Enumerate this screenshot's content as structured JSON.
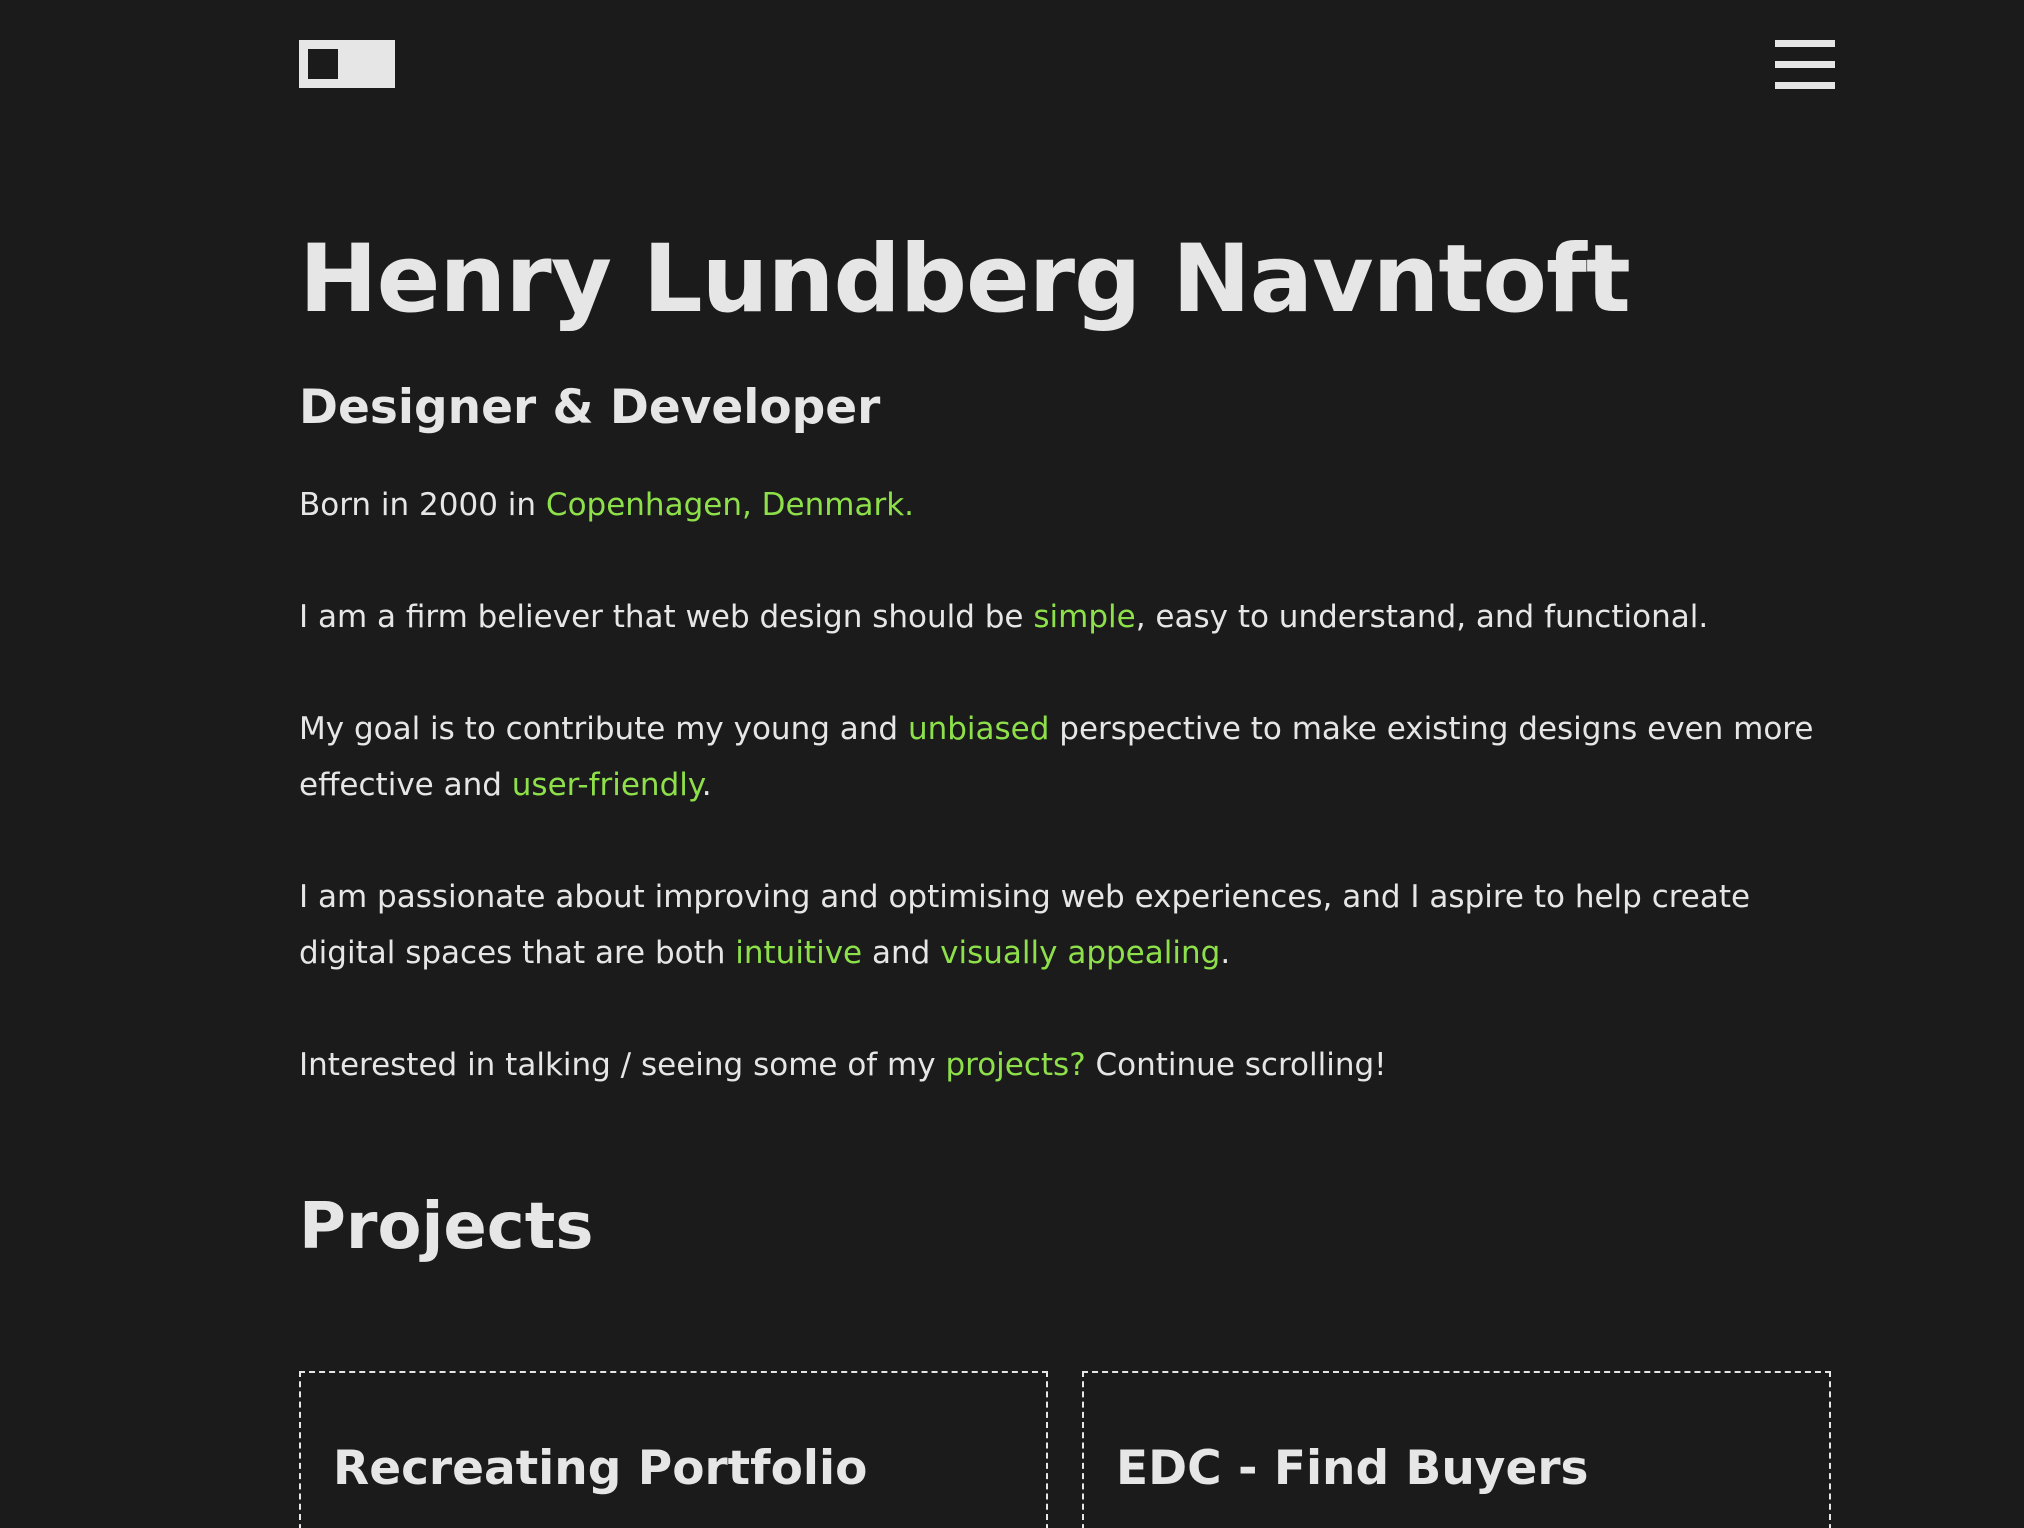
{
  "header": {
    "theme_toggle_icon": "toggle-switch-icon",
    "menu_icon": "hamburger-menu-icon"
  },
  "hero": {
    "name": "Henry Lundberg Navntoft",
    "subtitle": "Designer & Developer"
  },
  "bio": {
    "p1": {
      "pre": "Born in 2000 in ",
      "link": "Copenhagen, Denmark."
    },
    "p2": {
      "pre": "I am a firm believer that web design should be ",
      "link": "simple",
      "post": ", easy to understand, and functional."
    },
    "p3": {
      "pre": "My goal is to contribute my young and ",
      "link1": "unbiased",
      "mid": " perspective to make existing designs even more effective and ",
      "link2": "user-friendly",
      "post": "."
    },
    "p4": {
      "pre": "I am passionate about improving and optimising web experiences, and I aspire to help create digital spaces that are both ",
      "link1": "intuitive",
      "mid": " and ",
      "link2": "visually appealing",
      "post": "."
    },
    "p5": {
      "pre": "Interested in talking / seeing some of my ",
      "link": "projects?",
      "post": " Continue scrolling!"
    }
  },
  "projects": {
    "title": "Projects",
    "cards": [
      {
        "title": "Recreating Portfolio"
      },
      {
        "title": "EDC - Find Buyers"
      }
    ]
  },
  "colors": {
    "background": "#1b1b1b",
    "text": "#e6e6e6",
    "accent": "#8ee04a"
  }
}
